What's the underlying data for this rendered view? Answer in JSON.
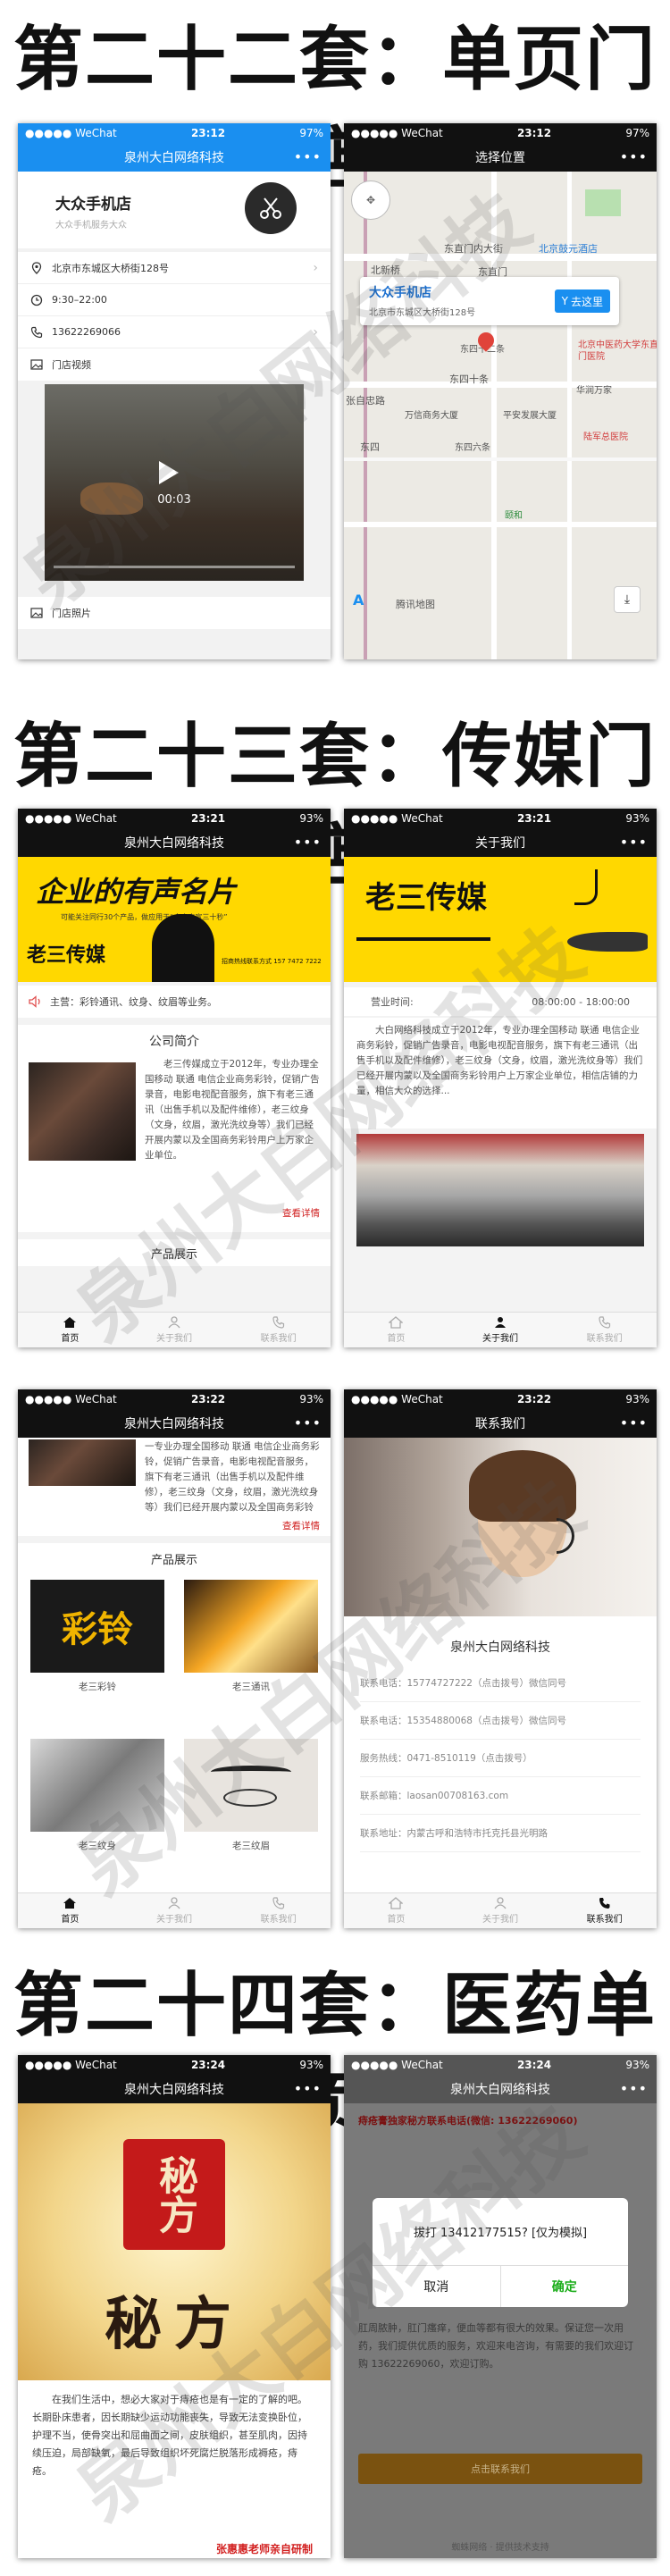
{
  "sections": {
    "s22": "第二十二套：单页门店",
    "s23": "第二十三套：传媒门店",
    "s24": "第二十四套：医药单页"
  },
  "status": {
    "carrier": "●●●●● WeChat",
    "battery_97": "97%",
    "battery_93": "93%",
    "t1": "23:12",
    "t2": "23:21",
    "t3": "23:22",
    "t4": "23:24"
  },
  "company": "泉州大白网络科技",
  "phone1": {
    "store_name": "大众手机店",
    "store_sub": "大众手机服务大众",
    "address": "北京市东城区大桥街128号",
    "hours": "9:30–22:00",
    "tel": "13622269066",
    "video_label": "门店视频",
    "video_time": "00:03",
    "photos_label": "门店照片"
  },
  "phone2": {
    "title": "选择位置",
    "store_name": "大众手机店",
    "address": "北京市东城区大桥街128号",
    "go_button": "去这里",
    "labels": [
      "东直门内大街",
      "北京鼓元酒店",
      "北新桥",
      "东直门",
      "东四十二条",
      "北京中医药大学东直门医院",
      "东四十条",
      "张自忠路",
      "万信商务大厦",
      "平安发展大厦",
      "华润万家",
      "东四",
      "陆军总医院",
      "东四六条",
      "颐和"
    ],
    "map_source": "腾讯地图"
  },
  "phone3": {
    "banner_title": "企业的有声名片",
    "banner_sub": "可能关注同行30个产品，做应用于“个人声宣三十秒”",
    "banner_name": "老三传媒",
    "banner_tel": "招商热线联系方式 157 7472 7222",
    "main_business": "主营：彩铃通讯、纹身、纹眉等业务。",
    "intro_title": "公司简介",
    "intro_text": "老三传媒成立于2012年，专业办理全国移动 联通 电信企业商务彩铃，促销广告录音，电影电视配音服务，旗下有老三通讯（出售手机以及配件维修），老三纹身（文身，纹眉，激光洗纹身等）我们已经开展内蒙以及全国商务彩铃用户上万家企业单位。",
    "more": "查看详情",
    "products_title": "产品展示"
  },
  "tabs": {
    "home": "首页",
    "about": "关于我们",
    "contact": "联系我们"
  },
  "phone4": {
    "title": "关于我们",
    "banner_name": "老三传媒",
    "hours_label": "营业时间:",
    "hours": "08:00:00 - 18:00:00",
    "about_text": "大白网络科技成立于2012年，专业办理全国移动 联通 电信企业商务彩铃，促销广告录音，电影电视配音服务，旗下有老三通讯（出售手机以及配件维修），老三纹身（文身，纹眉，激光洗纹身等）我们已经开展内蒙以及全国商务彩铃用户上万家企业单位，相信店铺的力量，相信大众的选择..."
  },
  "phone5": {
    "intro_text": "一专业办理全国移动 联通 电信企业商务彩铃，促销广告录音，电影电视配音服务，旗下有老三通讯（出售手机以及配件维修），老三纹身（文身，纹眉，激光洗纹身等）我们已经开展内蒙以及全国商务彩铃用户上万家企业单位。",
    "more": "查看详情",
    "products_title": "产品展示",
    "products": [
      "老三彩铃",
      "老三通讯",
      "老三纹身",
      "老三纹眉"
    ]
  },
  "phone6": {
    "title": "联系我们",
    "company": "泉州大白网络科技",
    "rows": [
      "联系电话：15774727222（点击拨号）微信同号",
      "联系电话：15354880068（点击拨号）微信同号",
      "服务热线：0471-8510119（点击拨号）",
      "联系邮箱：laosan00708163.com",
      "联系地址：内蒙古呼和浩特市托克托县光明路"
    ]
  },
  "phone7": {
    "seal_text": "秘方",
    "big_text": "秘方",
    "body": "在我们生活中，想必大家对于痔疮也是有一定的了解的吧。长期卧床患者，因长期缺少运动功能丧失，导致无法变换卧位，护理不当，使骨突出和屈曲面之间，皮肤组织，甚至肌肉，因持续压迫，局部缺氧，最后导致组织坏死腐烂脱落形成褥疮，痔疮。",
    "footer_red": "张惠惠老师亲自研制"
  },
  "phone8": {
    "head_red": "痔疮膏独家秘方联系电话(微信: 13622269060)",
    "dialog_text": "拔打 13412177515? [仅为模拟]",
    "cancel": "取消",
    "confirm": "确定",
    "body": "肛周脓肿，肛门瘙痒，便血等都有很大的效果。保证您一次用药，我们提供优质的服务，欢迎来电咨询，有需要的我们欢迎订购 13622269060，欢迎订购。",
    "cta": "点击联系我们",
    "footer": "蜘蛛网络 · 提供技术支持"
  },
  "watermark": "泉州大白网络科技"
}
